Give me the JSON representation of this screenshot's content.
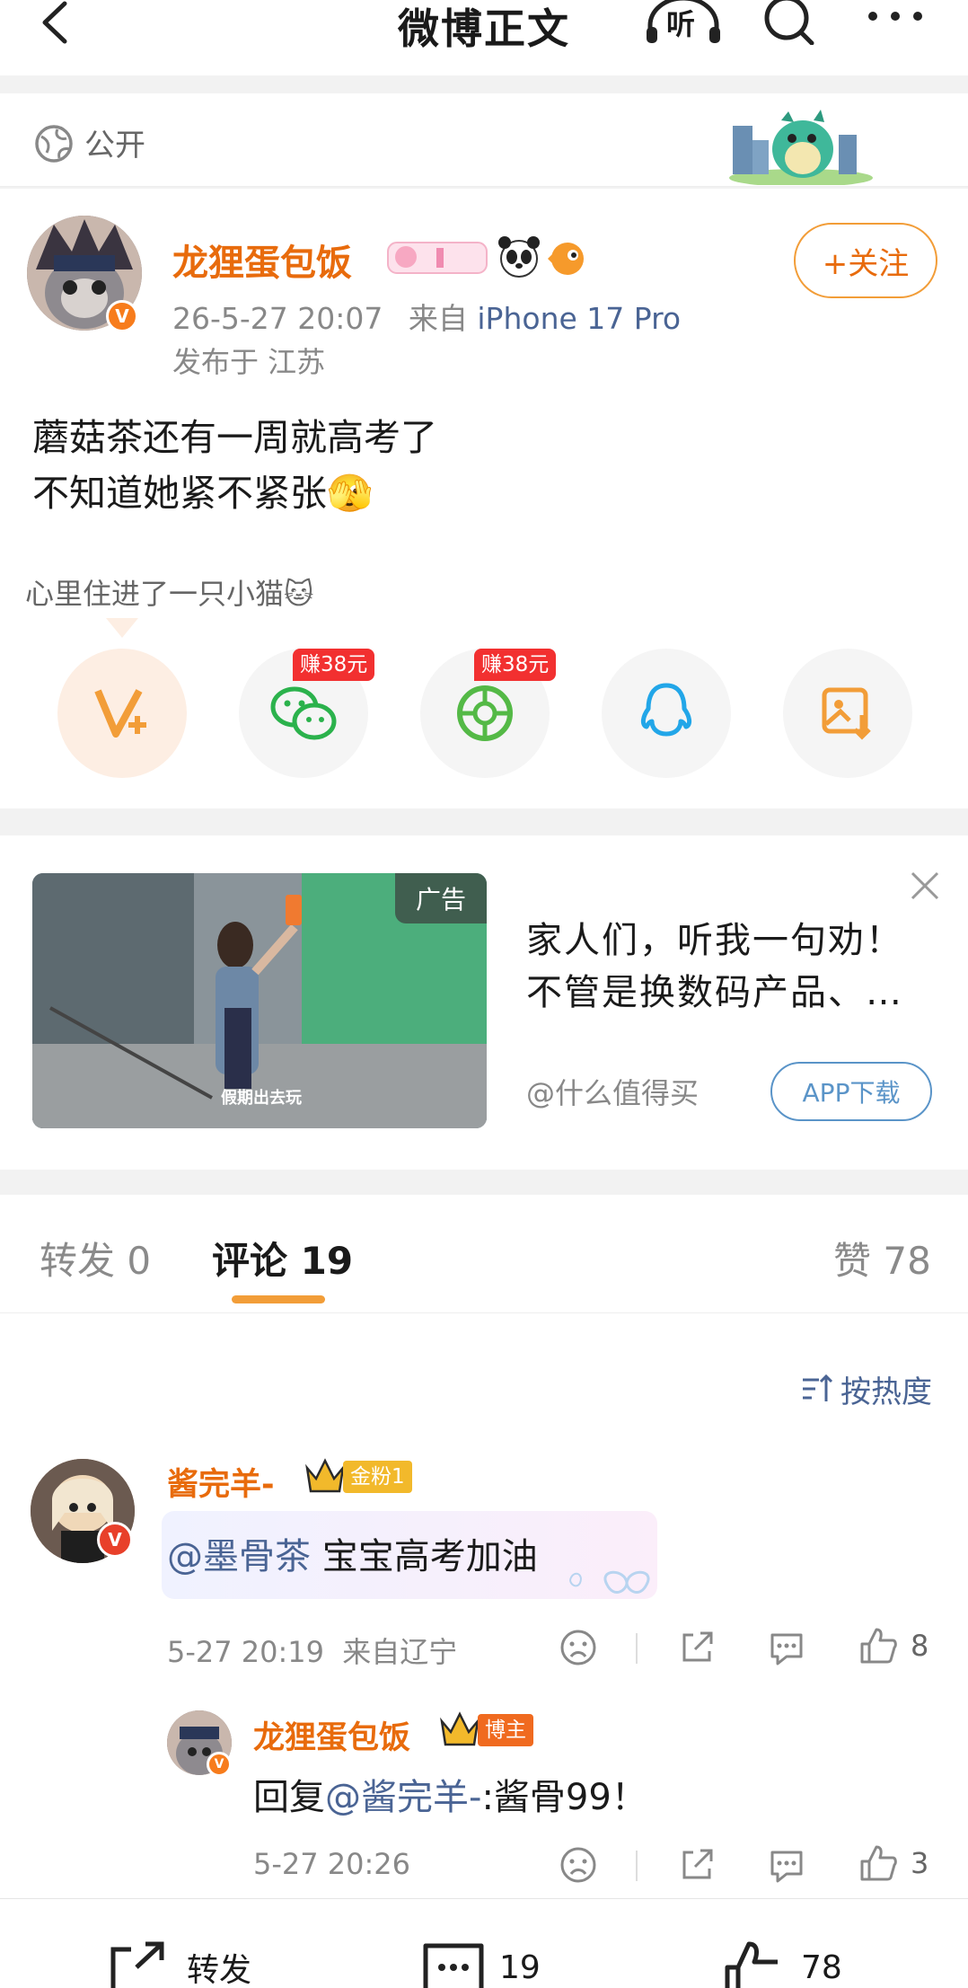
{
  "header": {
    "title": "微博正文",
    "listen_label": "听"
  },
  "visibility": {
    "label": "公开"
  },
  "post": {
    "author": "龙狸蛋包饭",
    "time": "26-5-27 20:07",
    "from_label": "来自",
    "device": "iPhone 17 Pro",
    "location": "发布于 江苏",
    "follow_label": "+关注",
    "text_line1": "蘑菇茶还有一周就高考了",
    "text_line2": "不知道她紧不紧张🫣",
    "mood": "心里住进了一只小猫🐱",
    "share_options": [
      {
        "name": "super-fans",
        "badge": ""
      },
      {
        "name": "wechat",
        "badge": "赚38元"
      },
      {
        "name": "moments",
        "badge": "赚38元"
      },
      {
        "name": "qq",
        "badge": ""
      },
      {
        "name": "save-image",
        "badge": ""
      }
    ]
  },
  "ad": {
    "tag": "广告",
    "caption": "假期出去玩",
    "text_line1": "家人们，听我一句劝！",
    "text_line2": "不管是换数码产品、…",
    "source": "@什么值得买",
    "button": "APP下载"
  },
  "tabs": {
    "repost": "转发 0",
    "comments": "评论 19",
    "likes": "赞 78"
  },
  "comments": {
    "sort_label": "按热度",
    "items": [
      {
        "user": "酱完羊-",
        "badge": "金粉1",
        "mention": "@墨骨茶",
        "text": " 宝宝高考加油",
        "time": "5-27 20:19",
        "location": "来自辽宁",
        "likes": "8"
      }
    ],
    "reply": {
      "user": "龙狸蛋包饭",
      "badge": "博主",
      "prefix": "回复",
      "mention": "@酱完羊-",
      "text": ":酱骨99！",
      "time": "5-27 20:26",
      "likes": "3"
    }
  },
  "bottom": {
    "repost": "转发",
    "comments": "19",
    "likes": "78"
  },
  "colors": {
    "accent_orange": "#e86b0c",
    "link_blue": "#4a6494",
    "tab_underline": "#f29d38",
    "earn_badge": "#f23030"
  }
}
